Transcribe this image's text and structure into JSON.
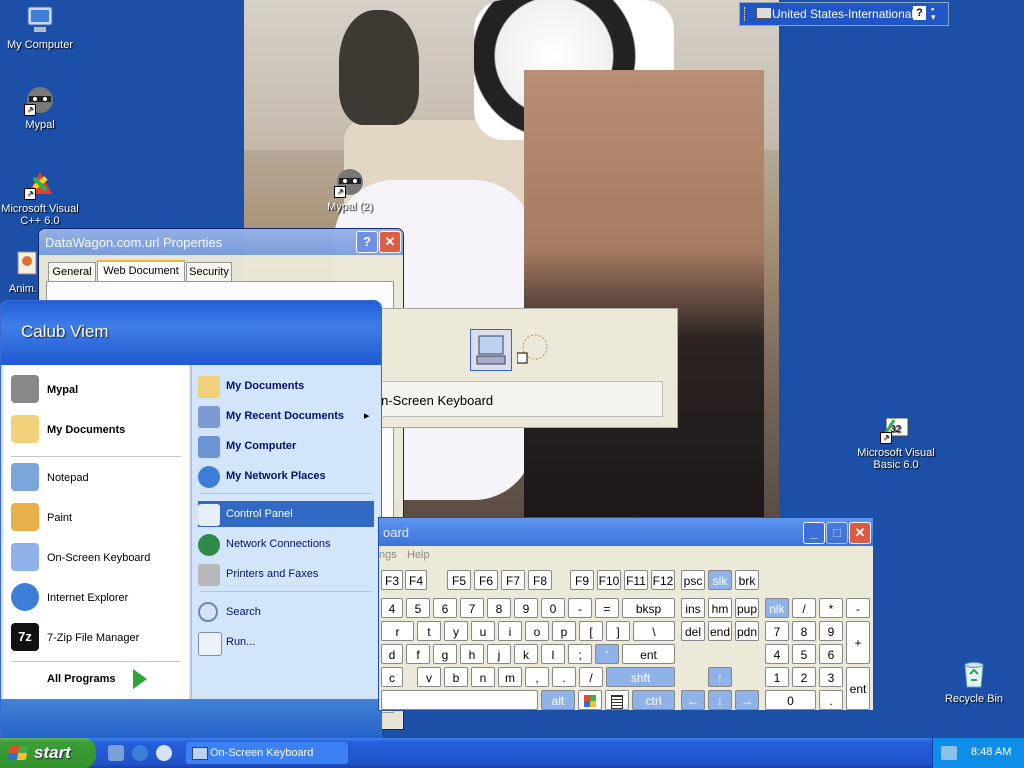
{
  "desktop": {
    "icons": [
      {
        "label": "My Computer"
      },
      {
        "label": "Mypal"
      },
      {
        "label": "Microsoft Visual C++ 6.0"
      },
      {
        "label": "Anim..."
      },
      {
        "label": "Mypal (2)"
      },
      {
        "label": "Microsoft Visual Basic 6.0"
      },
      {
        "label": "Recycle Bin"
      }
    ]
  },
  "language_bar": {
    "language": "United States-International",
    "help": "?"
  },
  "properties_dialog": {
    "title": "DataWagon.com.url Properties",
    "tabs": [
      "General",
      "Web Document",
      "Security"
    ],
    "help_btn": "?",
    "close_btn": "✕"
  },
  "run_popup": {
    "label": "On-Screen Keyboard"
  },
  "start_menu": {
    "user": "Calub Viem",
    "pinned": [
      {
        "label": "Mypal"
      },
      {
        "label": "My Documents"
      }
    ],
    "recent": [
      {
        "label": "Notepad"
      },
      {
        "label": "Paint"
      },
      {
        "label": "On-Screen Keyboard"
      },
      {
        "label": "Internet Explorer"
      },
      {
        "label": "7-Zip File Manager"
      }
    ],
    "all_programs": "All Programs",
    "places": [
      {
        "label": "My Documents"
      },
      {
        "label": "My Recent Documents",
        "arrow": "▸"
      },
      {
        "label": "My Computer"
      },
      {
        "label": "My Network Places"
      }
    ],
    "system": [
      {
        "label": "Control Panel"
      },
      {
        "label": "Network Connections"
      },
      {
        "label": "Printers and Faxes"
      }
    ],
    "tools": [
      {
        "label": "Search"
      },
      {
        "label": "Run..."
      }
    ]
  },
  "keyboard": {
    "title": "oard",
    "menu": [
      "ngs",
      "Help"
    ],
    "fkeys": [
      "F3",
      "F4",
      "F5",
      "F6",
      "F7",
      "F8",
      "F9",
      "F10",
      "F11",
      "F12"
    ],
    "row1_nav": [
      "psc",
      "slk",
      "brk"
    ],
    "row2": [
      "4",
      "5",
      "6",
      "7",
      "8",
      "9",
      "0",
      "-",
      "=",
      "bksp"
    ],
    "row2_nav": [
      "ins",
      "hm",
      "pup"
    ],
    "row2_num": [
      "nlk",
      "/",
      "*",
      "-"
    ],
    "row3": [
      "r",
      "t",
      "y",
      "u",
      "i",
      "o",
      "p",
      "[",
      "]",
      "\\"
    ],
    "row3_nav": [
      "del",
      "end",
      "pdn"
    ],
    "row3_num": [
      "7",
      "8",
      "9",
      "+"
    ],
    "row4": [
      "d",
      "f",
      "g",
      "h",
      "j",
      "k",
      "l",
      ";",
      "'",
      "ent"
    ],
    "row4_num": [
      "4",
      "5",
      "6"
    ],
    "row5": [
      "c",
      "v",
      "b",
      "n",
      "m",
      ",",
      ".",
      "/",
      "shft"
    ],
    "row5_num": [
      "1",
      "2",
      "3",
      "ent"
    ],
    "row6_alt": "alt",
    "row6_ctrl": "ctrl",
    "row6_num": [
      "0",
      "."
    ],
    "arrows": [
      "↑",
      "←",
      "↓",
      "→"
    ]
  },
  "taskbar": {
    "start_label": "start",
    "task": "On-Screen Keyboard",
    "clock": "8:48 AM"
  },
  "colors": {
    "accent": "#316ac5",
    "taskbar": "#245edb",
    "start": "#3c9e35"
  }
}
